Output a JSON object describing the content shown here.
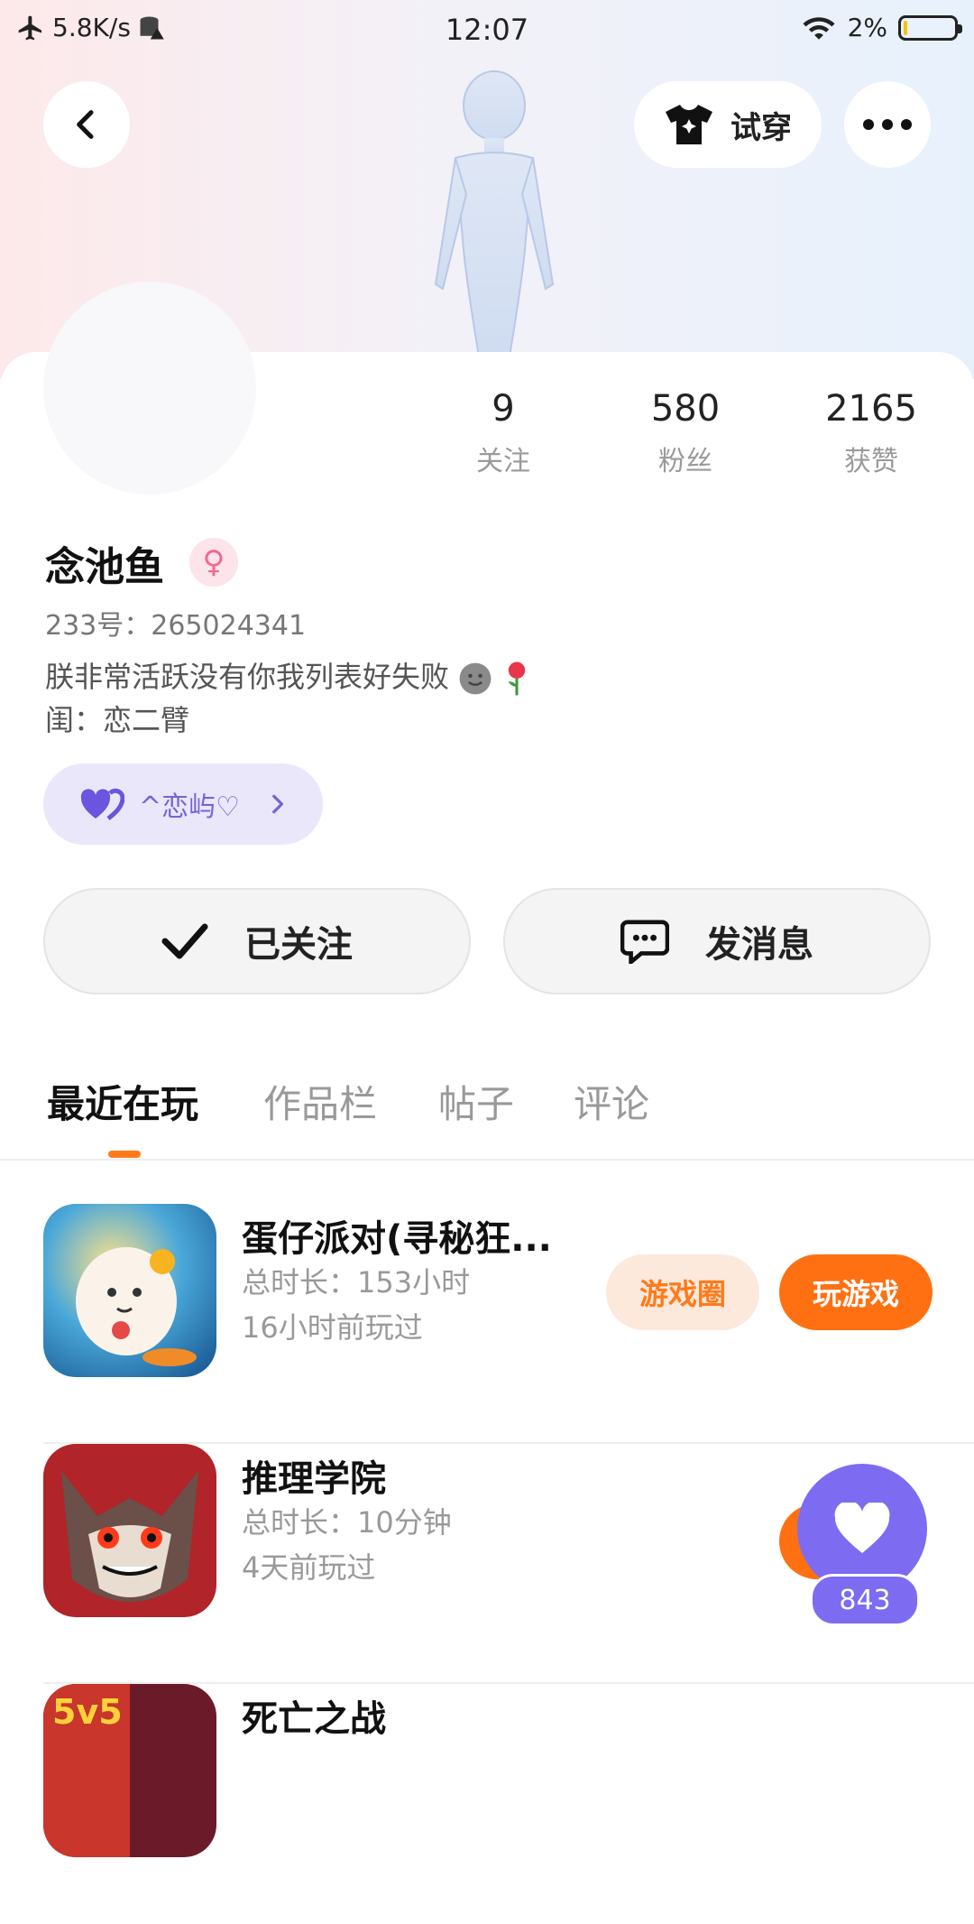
{
  "status_bar": {
    "speed": "5.8K/s",
    "time": "12:07",
    "battery": "2%"
  },
  "header": {
    "try_on_label": "试穿"
  },
  "stats": [
    {
      "value": "9",
      "label": "关注"
    },
    {
      "value": "580",
      "label": "粉丝"
    },
    {
      "value": "2165",
      "label": "获赞"
    }
  ],
  "profile": {
    "name": "念池鱼",
    "gender_symbol": "♀",
    "id_line": "233号：265024341",
    "bio_line1": "朕非常活跃没有你我列表好失败",
    "bio_line2": "闺：恋二臂",
    "couple_label": "^恋屿♡"
  },
  "actions": {
    "followed_label": "已关注",
    "message_label": "发消息"
  },
  "tabs": [
    "最近在玩",
    "作品栏",
    "帖子",
    "评论"
  ],
  "games": [
    {
      "title": "蛋仔派对(寻秘狂...",
      "duration": "总时长：153小时",
      "last_played": "16小时前玩过",
      "circle_label": "游戏圈",
      "play_label": "玩游戏"
    },
    {
      "title": "推理学院",
      "duration": "总时长：10分钟",
      "last_played": "4天前玩过"
    },
    {
      "title": "死亡之战"
    }
  ],
  "like": {
    "count": "843"
  },
  "colors": {
    "accent_orange": "#ff7012",
    "accent_purple": "#7d6bf2"
  }
}
